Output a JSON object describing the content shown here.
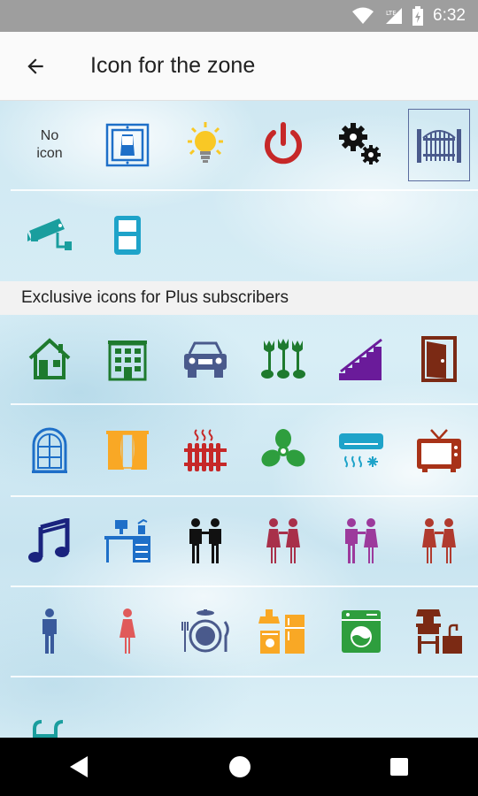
{
  "status_bar": {
    "time": "6:32",
    "network": "LTE"
  },
  "app_bar": {
    "title": "Icon for the zone"
  },
  "basic_icons": {
    "no_icon_label_line1": "No",
    "no_icon_label_line2": "icon",
    "items": [
      "no-icon",
      "switch-icon",
      "bulb-icon",
      "power-icon",
      "gears-icon",
      "gate-icon",
      "camera-icon",
      "cylinder-icon"
    ],
    "selected": "gate-icon"
  },
  "plus_section": {
    "header": "Exclusive icons for Plus subscribers"
  },
  "colors": {
    "green": "#1e7a2e",
    "purple": "#6a1b9a",
    "brown": "#7b2a14",
    "blue": "#1e6fc8",
    "amber": "#f9a825",
    "red": "#b71c1c",
    "navy": "#1a237e",
    "power_red": "#c62828",
    "cyan": "#1ea3c9"
  },
  "nav_bar": {
    "back": "back-nav",
    "home": "home-nav",
    "recents": "recents-nav"
  }
}
